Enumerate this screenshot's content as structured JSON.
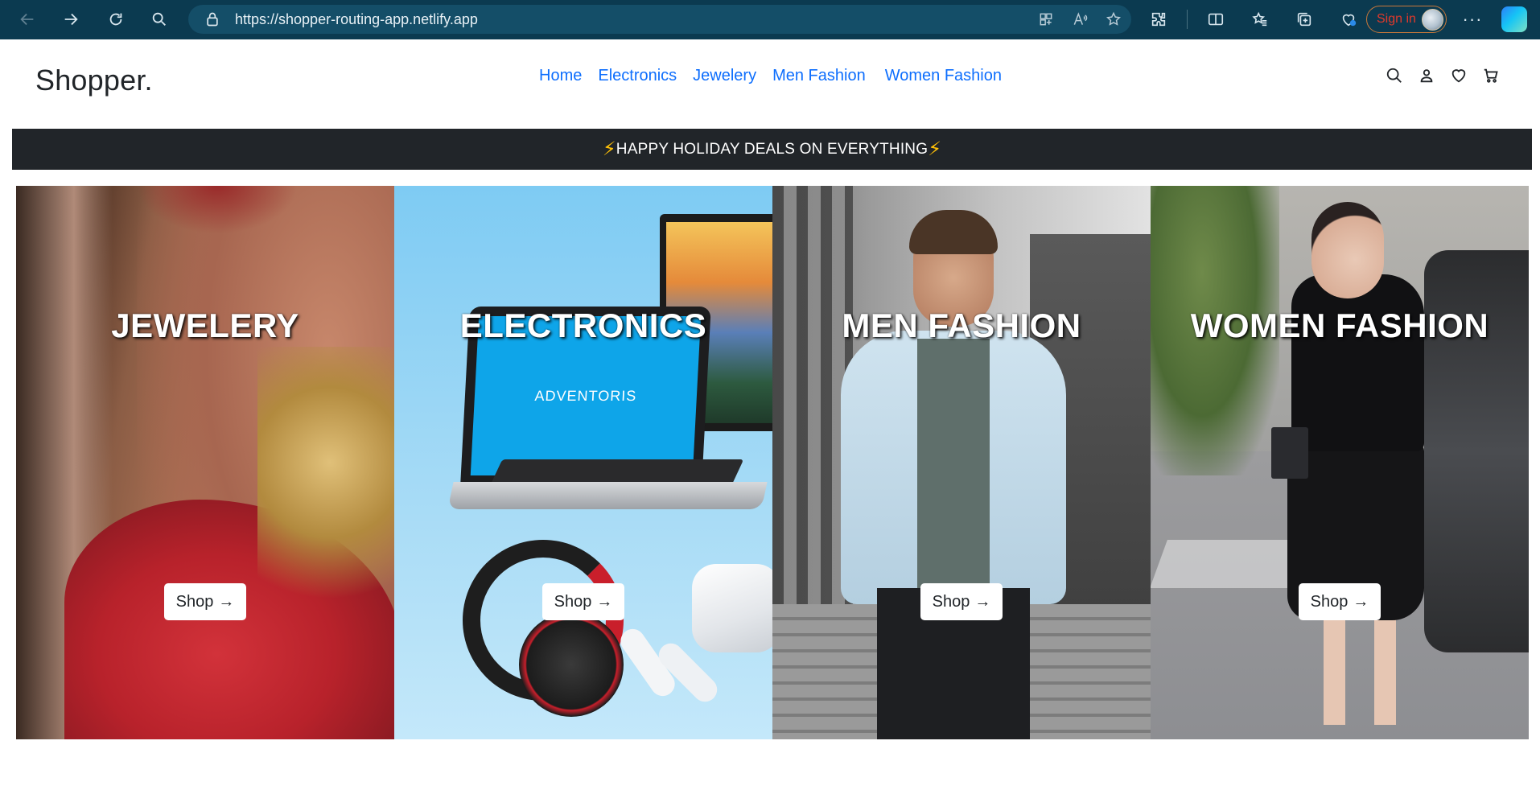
{
  "browser": {
    "url": "https://shopper-routing-app.netlify.app",
    "sign_in": "Sign in"
  },
  "site": {
    "logo": "Shopper.",
    "nav": [
      {
        "label": "Home"
      },
      {
        "label": "Electronics"
      },
      {
        "label": "Jewelery"
      },
      {
        "label": "Men Fashion"
      },
      {
        "label": "Women Fashion"
      }
    ],
    "promo": "HAPPY HOLIDAY DEALS ON EVERYTHING",
    "categories": [
      {
        "title": "JEWELERY",
        "button": "Shop"
      },
      {
        "title": "ELECTRONICS",
        "button": "Shop",
        "screen_text": "ADVENTORIS"
      },
      {
        "title": "MEN FASHION",
        "button": "Shop"
      },
      {
        "title": "WOMEN FASHION",
        "button": "Shop"
      }
    ]
  },
  "colors": {
    "browser_bar": "#0b3a50",
    "nav_link": "#0d6efd",
    "promo_bg": "#212529",
    "bolt": "#ffc107"
  }
}
